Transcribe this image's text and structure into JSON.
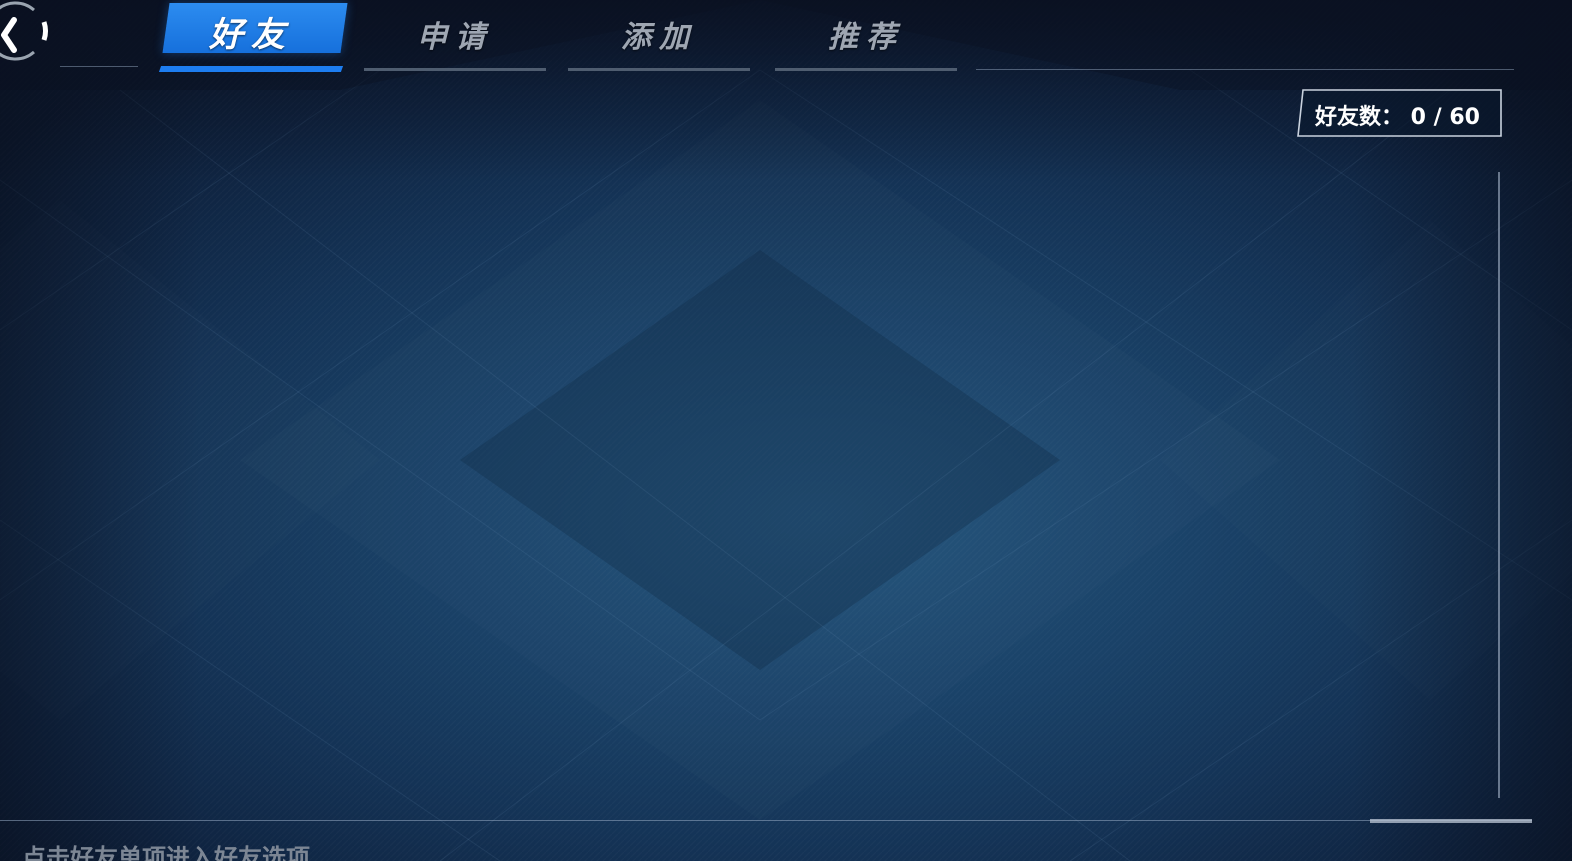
{
  "navigation": {
    "back_label": "❮"
  },
  "tabs": [
    {
      "label": "好友",
      "active": true
    },
    {
      "label": "申请",
      "active": false
    },
    {
      "label": "添加",
      "active": false
    },
    {
      "label": "推荐",
      "active": false
    }
  ],
  "friend_count": {
    "label": "好友数：",
    "current": "0",
    "max": "60",
    "display": "好友数： 0 / 60"
  },
  "friends": [],
  "footer": {
    "hint": "点击好友单项进入好友选项"
  },
  "colors": {
    "accent": "#1d7df0",
    "tab_inactive_text": "#9ea6b2",
    "background": "#1a4268"
  },
  "icons": {
    "back": "back-arrow-icon"
  }
}
